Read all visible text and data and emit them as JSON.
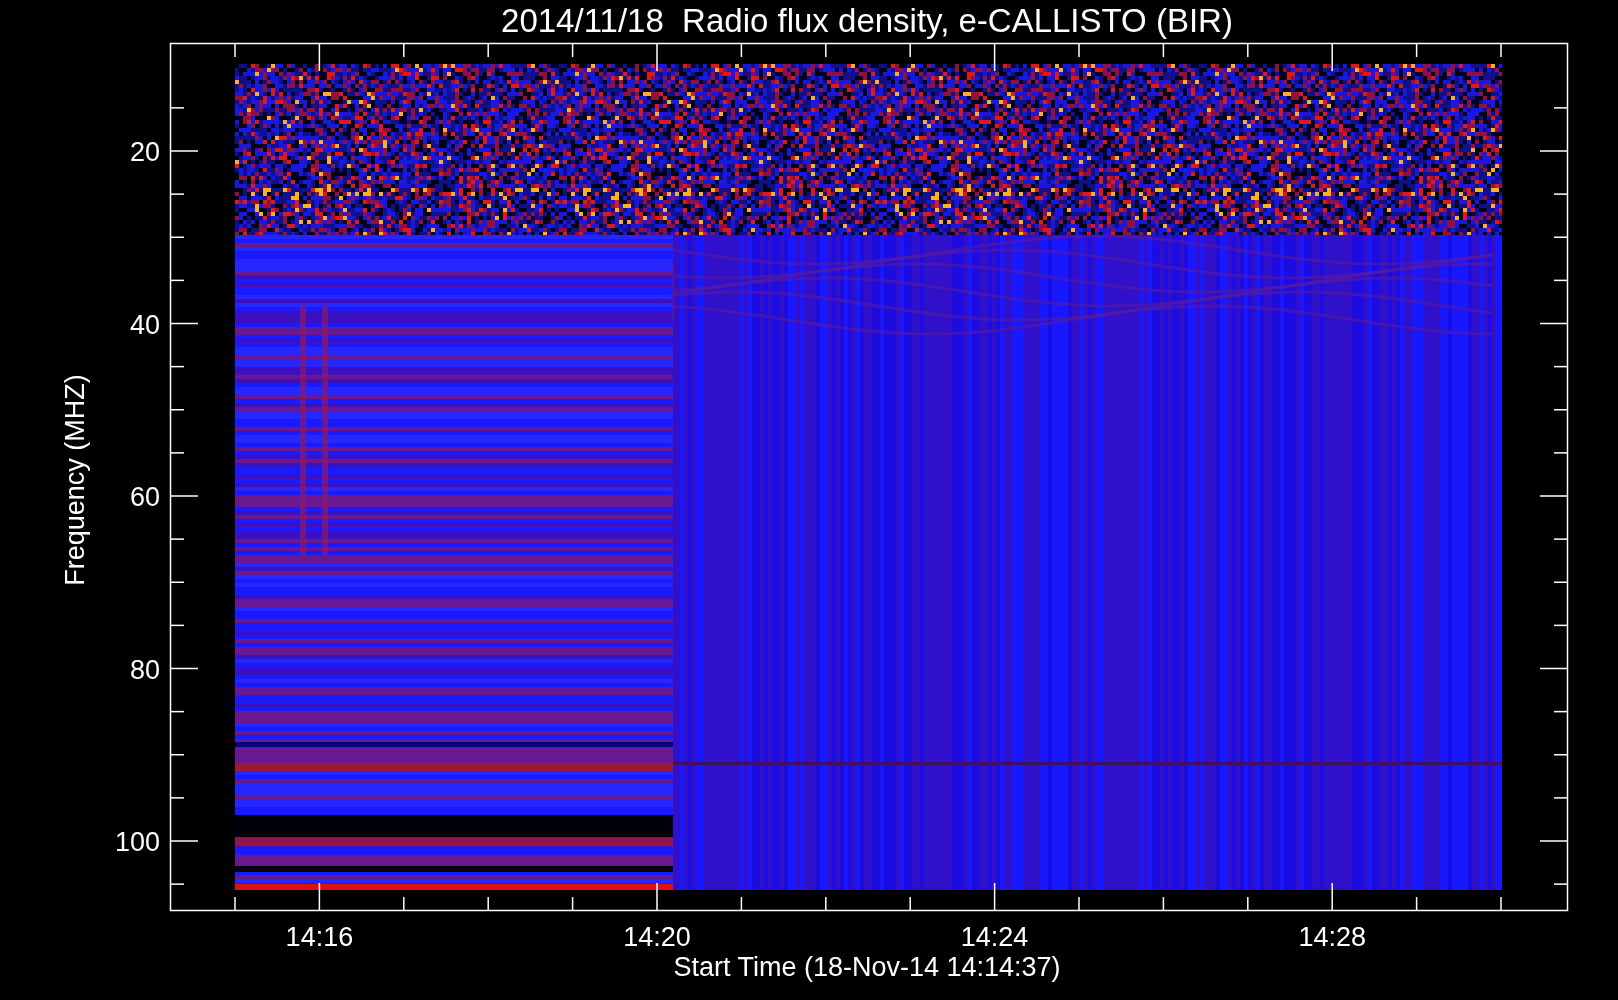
{
  "title": "2014/11/18  Radio flux density, e-CALLISTO (BIR)",
  "y_axis": {
    "label": "Frequency (MHZ)",
    "ticks": [
      "20",
      "40",
      "60",
      "80",
      "100"
    ]
  },
  "x_axis": {
    "label": "Start Time (18-Nov-14 14:14:37)",
    "ticks": [
      "14:16",
      "14:20",
      "14:24",
      "14:28"
    ]
  }
}
